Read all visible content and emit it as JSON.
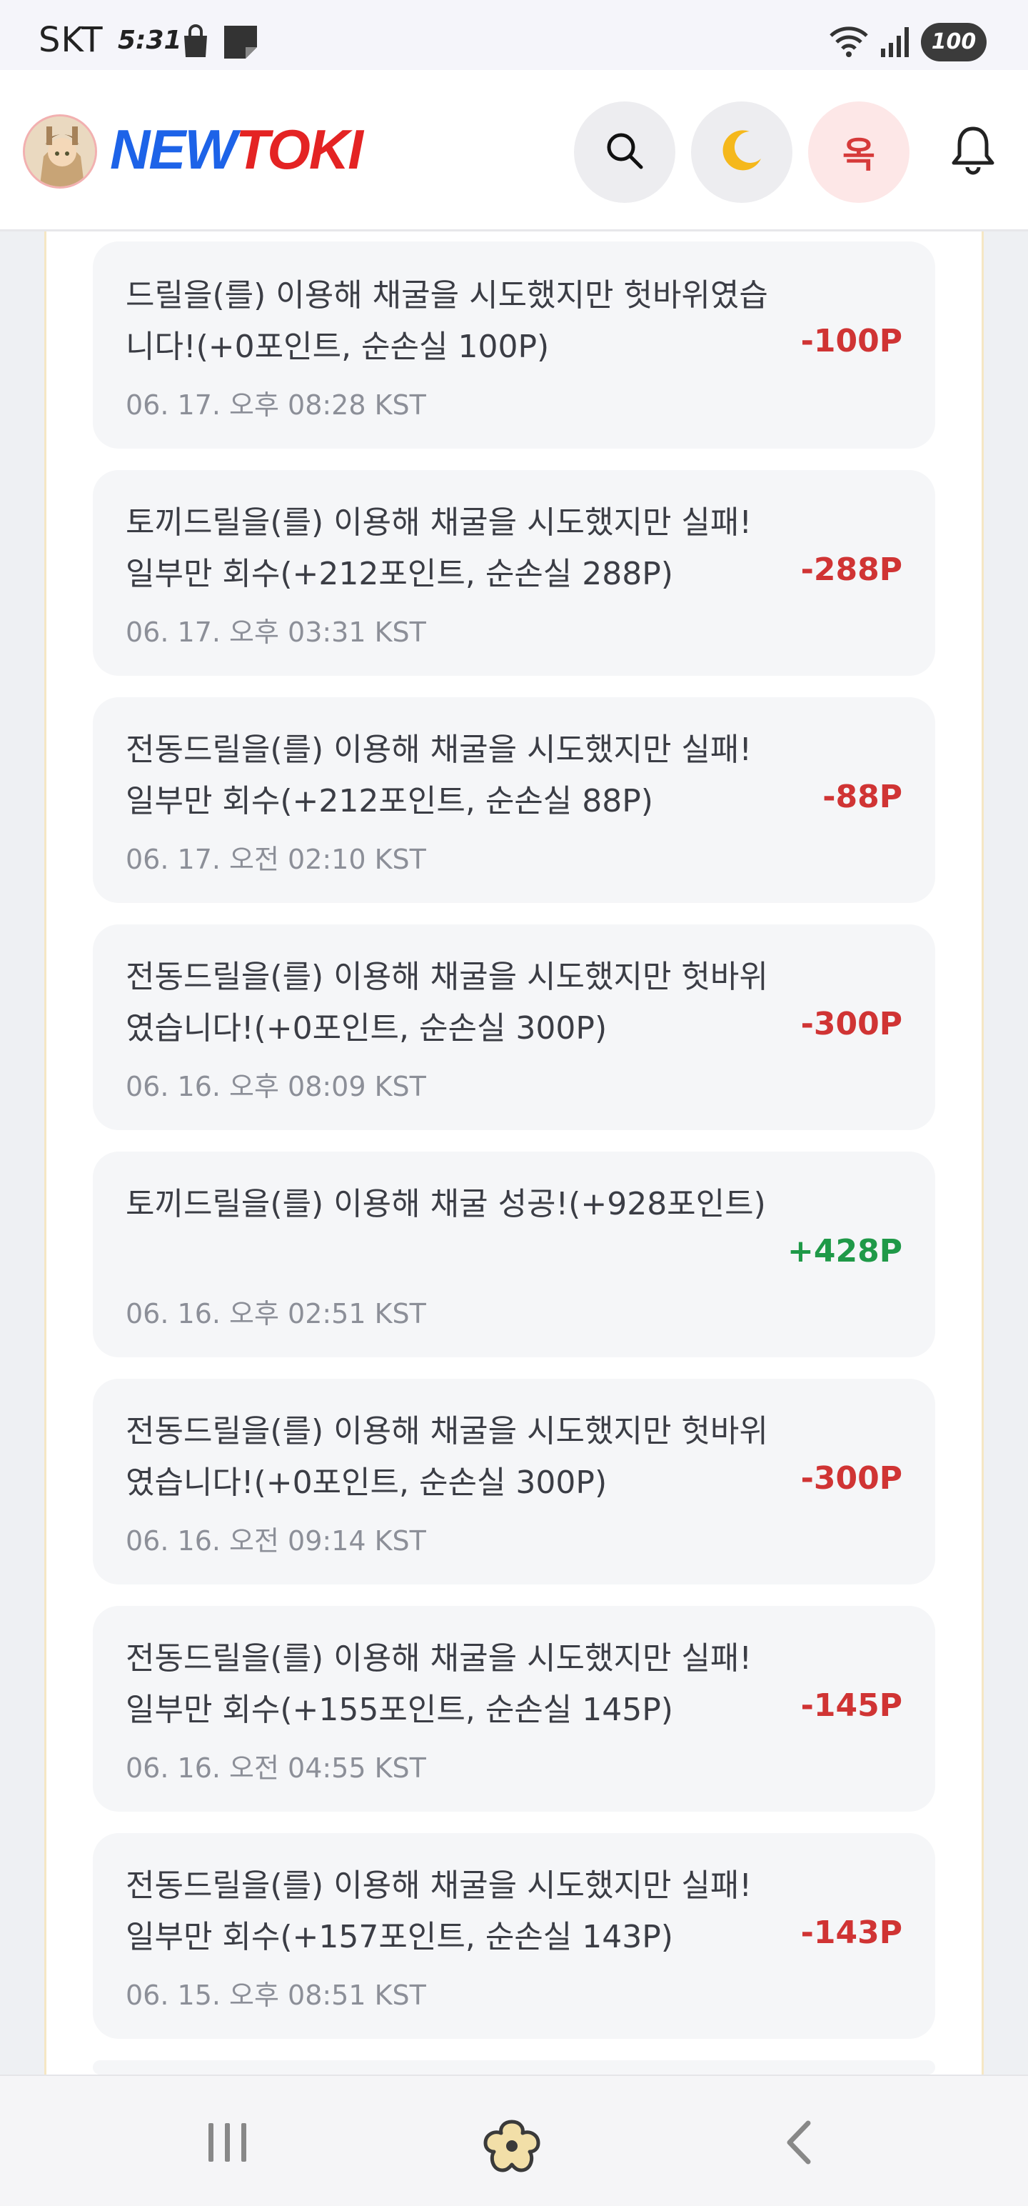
{
  "status_bar": {
    "carrier": "SKT",
    "time": "5:31",
    "battery": "100",
    "icons": [
      "shopping-bag-icon",
      "note-icon",
      "wifi-icon",
      "signal-icon",
      "battery-icon"
    ]
  },
  "header": {
    "logo_part1": "NEW",
    "logo_part2": "TOKI",
    "profile_label": "옥",
    "icons": [
      "avatar-image",
      "search-icon",
      "moon-icon",
      "bell-icon"
    ],
    "colors": {
      "logo_blue": "#1d63e8",
      "logo_red": "#e42323",
      "profile_text": "#d63a3a"
    }
  },
  "history": {
    "items": [
      {
        "desc": "드릴을(를) 이용해 채굴을 시도했지만 헛바위였습니다!(+0포인트, 순손실 100P)",
        "date": "06. 17. 오후 08:28 KST",
        "amount": "-100P"
      },
      {
        "desc": "토끼드릴을(를) 이용해 채굴을 시도했지만 실패! 일부만 회수(+212포인트, 순손실 288P)",
        "date": "06. 17. 오후 03:31 KST",
        "amount": "-288P"
      },
      {
        "desc": "전동드릴을(를) 이용해 채굴을 시도했지만 실패! 일부만 회수(+212포인트, 순손실 88P)",
        "date": "06. 17. 오전 02:10 KST",
        "amount": "-88P"
      },
      {
        "desc": "전동드릴을(를) 이용해 채굴을 시도했지만 헛바위였습니다!(+0포인트, 순손실 300P)",
        "date": "06. 16. 오후 08:09 KST",
        "amount": "-300P"
      },
      {
        "desc": "토끼드릴을(를) 이용해 채굴 성공!(+928포인트)",
        "date": "06. 16. 오후 02:51 KST",
        "amount": "+428P"
      },
      {
        "desc": "전동드릴을(를) 이용해 채굴을 시도했지만 헛바위였습니다!(+0포인트, 순손실 300P)",
        "date": "06. 16. 오전 09:14 KST",
        "amount": "-300P"
      },
      {
        "desc": "전동드릴을(를) 이용해 채굴을 시도했지만 실패! 일부만 회수(+155포인트, 순손실 145P)",
        "date": "06. 16. 오전 04:55 KST",
        "amount": "-145P"
      },
      {
        "desc": "전동드릴을(를) 이용해 채굴을 시도했지만 실패! 일부만 회수(+157포인트, 순손실 143P)",
        "date": "06. 15. 오후 08:51 KST",
        "amount": "-143P"
      }
    ],
    "colors": {
      "negative": "#d03434",
      "positive": "#1f9948"
    }
  },
  "nav_bar": {
    "icons": [
      "recent-apps-icon",
      "home-icon",
      "back-icon"
    ]
  }
}
